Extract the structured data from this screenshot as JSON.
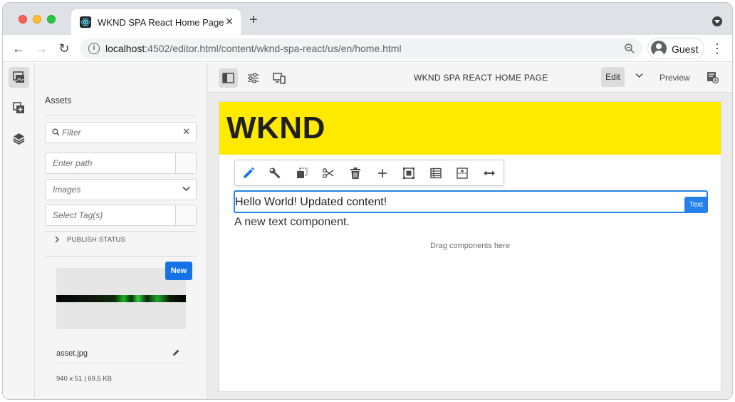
{
  "browser": {
    "tab_title": "WKND SPA React Home Page",
    "url_host": "localhost",
    "url_path": ":4502/editor.html/content/wknd-spa-react/us/en/home.html",
    "profile_name": "Guest"
  },
  "assets_panel": {
    "title": "Assets",
    "filter_placeholder": "Filter",
    "path_placeholder": "Enter path",
    "type_select": "Images",
    "tags_placeholder": "Select Tag(s)",
    "publish_status": "PUBLISH STATUS",
    "asset": {
      "badge": "New",
      "name": "asset.jpg",
      "meta": "940 x 51 | 69.5 KB"
    }
  },
  "editor_header": {
    "page_title": "WKND SPA REACT HOME PAGE",
    "edit_label": "Edit",
    "preview_label": "Preview"
  },
  "page": {
    "logo": "WKND",
    "text_component": "Hello World! Updated content!",
    "component_label": "Text",
    "text2": "A new text component.",
    "drop_zone": "Drag components here"
  },
  "colors": {
    "hero_yellow": "#ffea00",
    "accent_blue": "#1473e6",
    "selection_blue": "#2680eb"
  },
  "icons": {
    "component_toolbar": [
      "edit-icon",
      "configure-icon",
      "copy-icon",
      "cut-icon",
      "delete-icon",
      "insert-icon",
      "group-icon",
      "layout-icon",
      "parent-icon",
      "stretch-icon"
    ]
  }
}
